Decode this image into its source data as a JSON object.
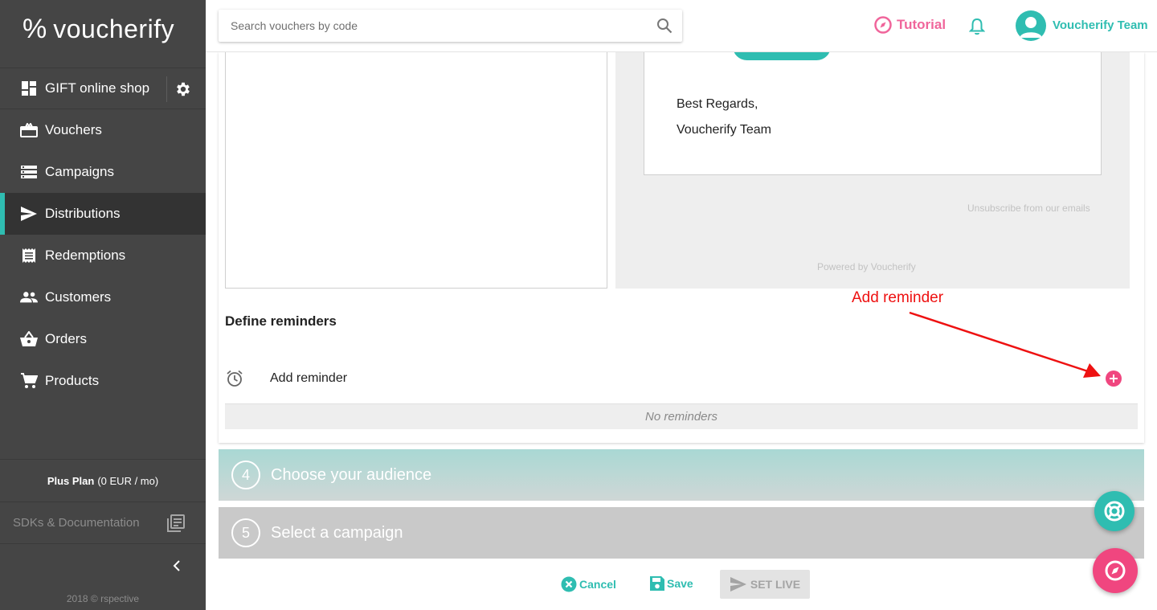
{
  "app": {
    "logo_mark": "%",
    "logo_text": "voucherify"
  },
  "sidebar": {
    "project": "GIFT online shop",
    "items": [
      {
        "label": "Vouchers",
        "icon": "voucher-icon",
        "active": false
      },
      {
        "label": "Campaigns",
        "icon": "campaigns-icon",
        "active": false
      },
      {
        "label": "Distributions",
        "icon": "send-icon",
        "active": true
      },
      {
        "label": "Redemptions",
        "icon": "receipt-icon",
        "active": false
      },
      {
        "label": "Customers",
        "icon": "people-icon",
        "active": false
      },
      {
        "label": "Orders",
        "icon": "basket-icon",
        "active": false
      },
      {
        "label": "Products",
        "icon": "cart-icon",
        "active": false
      }
    ],
    "plan_name": "Plus Plan",
    "plan_price": "(0 EUR / mo)",
    "sdk_label": "SDKs & Documentation",
    "copyright": "2018 © rspective"
  },
  "topbar": {
    "search_placeholder": "Search vouchers by code",
    "tutorial_label": "Tutorial",
    "username": "Voucherify Team"
  },
  "preview": {
    "regards": "Best Regards,",
    "team": "Voucherify Team",
    "unsubscribe": "Unsubscribe from our emails",
    "powered": "Powered by Voucherify"
  },
  "reminders": {
    "heading": "Define reminders",
    "add_label": "Add reminder",
    "empty": "No reminders"
  },
  "annotation": {
    "label": "Add reminder"
  },
  "steps": [
    {
      "number": "4",
      "title": "Choose your audience"
    },
    {
      "number": "5",
      "title": "Select a campaign"
    }
  ],
  "actions": {
    "cancel": "Cancel",
    "save": "Save",
    "set_live": "SET LIVE"
  },
  "colors": {
    "accent": "#2fbdb1",
    "pink": "#f0467f",
    "sidebar": "#454545",
    "annotation": "#ee1111"
  }
}
